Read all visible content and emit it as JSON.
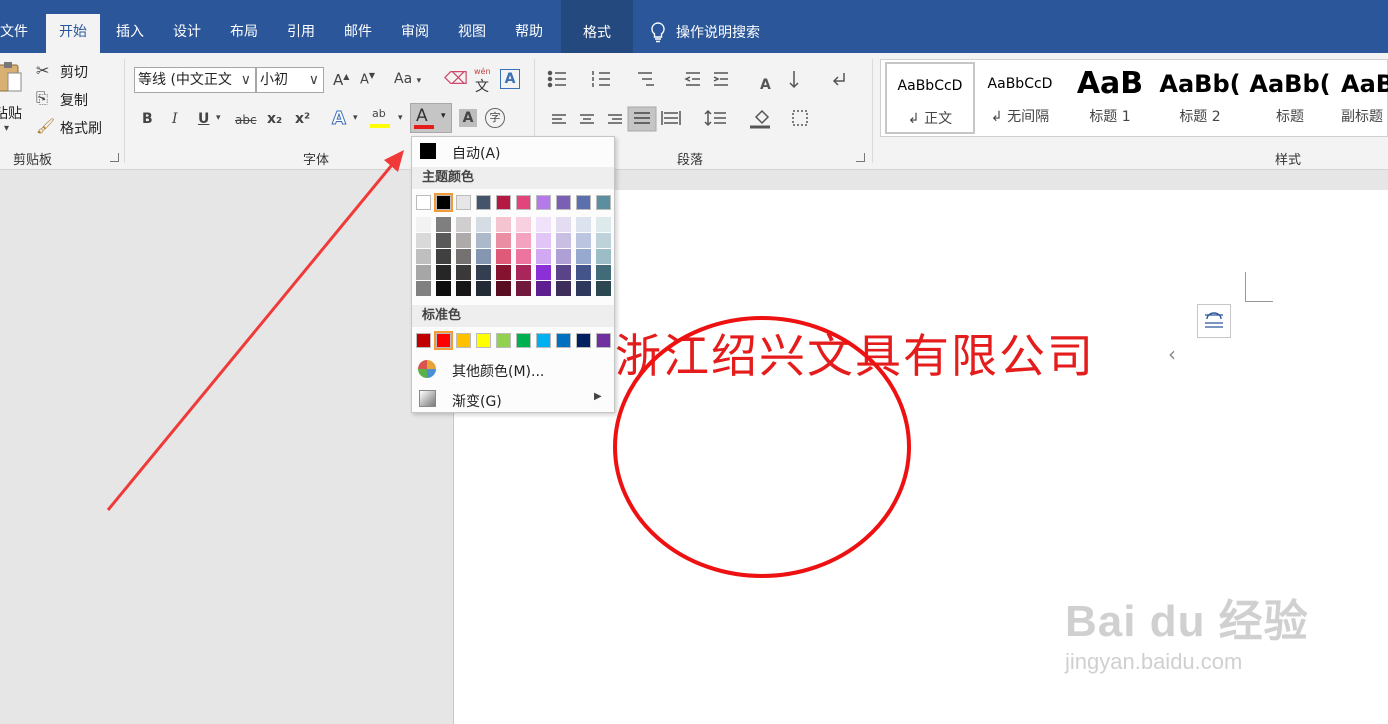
{
  "tabs": [
    "文件",
    "开始",
    "插入",
    "设计",
    "布局",
    "引用",
    "邮件",
    "审阅",
    "视图",
    "帮助"
  ],
  "active_tab": "开始",
  "format_tab": "格式",
  "tell_me": "操作说明搜索",
  "clipboard": {
    "paste": "粘贴",
    "cut": "剪切",
    "copy": "复制",
    "format_painter": "格式刷",
    "group_label": "剪贴板"
  },
  "font": {
    "font_name": "等线 (中文正文",
    "font_size": "小初",
    "group_label": "字体",
    "aa": "Aa",
    "bold": "B",
    "italic": "I",
    "underline": "U",
    "strike": "abc",
    "sub": "x₂",
    "sup": "x²",
    "phonetic_top": "wén",
    "phonetic_bottom": "文",
    "boxed": "A",
    "grow": "A",
    "shrink": "A",
    "effects": "A",
    "highlight": "ab",
    "font_color": "A",
    "char_shade": "A",
    "enclosed": "字",
    "highlight_color": "#ffff00",
    "font_color_bar": "#e51c1c"
  },
  "paragraph": {
    "group_label": "段落"
  },
  "styles": {
    "group_label": "样式",
    "items": [
      {
        "sample": "AaBbCcD",
        "name": "↲ 正文"
      },
      {
        "sample": "AaBbCcD",
        "name": "↲ 无间隔"
      },
      {
        "sample": "AaB",
        "name": "标题 1"
      },
      {
        "sample": "AaBb(",
        "name": "标题 2"
      },
      {
        "sample": "AaBb(",
        "name": "标题"
      },
      {
        "sample": "AaB",
        "name": "副标题"
      }
    ]
  },
  "color_menu": {
    "auto": "自动(A)",
    "theme_header": "主题颜色",
    "standard_header": "标准色",
    "more_colors": "其他颜色(M)...",
    "gradient": "渐变(G)",
    "theme_top": [
      "#ffffff",
      "#000000",
      "#e7e6e6",
      "#44546a",
      "#b31942",
      "#e0457b",
      "#b57aea",
      "#7a5fb5",
      "#5b6fae",
      "#5b8fa0"
    ],
    "theme_shades": [
      [
        "#f2f2f2",
        "#d9d9d9",
        "#bfbfbf",
        "#a6a6a6",
        "#808080"
      ],
      [
        "#7f7f7f",
        "#595959",
        "#404040",
        "#262626",
        "#0d0d0d"
      ],
      [
        "#d0cece",
        "#aeaaaa",
        "#757171",
        "#3a3838",
        "#171616"
      ],
      [
        "#d6dce4",
        "#acb9ca",
        "#8496b0",
        "#333f50",
        "#222a35"
      ],
      [
        "#f4c4d1",
        "#ea8ea4",
        "#df5a79",
        "#851330",
        "#590d20"
      ],
      [
        "#f9d0df",
        "#f3a2bf",
        "#ec749f",
        "#a82659",
        "#70193c"
      ],
      [
        "#f0e2fb",
        "#e1c5f6",
        "#d1a8f2",
        "#8b2fd6",
        "#5d1f8f"
      ],
      [
        "#e4ddf1",
        "#c9bfe2",
        "#ae9fd4",
        "#5a4489",
        "#3c2d5b"
      ],
      [
        "#dde2ef",
        "#bbc5df",
        "#98a9cf",
        "#43548a",
        "#2d385c"
      ],
      [
        "#dee9ec",
        "#bdd2d9",
        "#9cbcc6",
        "#426b78",
        "#2c4750"
      ]
    ],
    "standard": [
      "#c00000",
      "#ff0000",
      "#ffc000",
      "#ffff00",
      "#92d050",
      "#00b050",
      "#00b0f0",
      "#0070c0",
      "#002060",
      "#7030a0"
    ],
    "selected_theme_index": 1,
    "selected_standard_index": 1
  },
  "document": {
    "company": "浙江绍兴文具有限公司",
    "text_color": "#e51c1c",
    "circle_color": "#ee1111"
  },
  "watermark": {
    "main": "Bai du 经验",
    "sub": "jingyan.baidu.com"
  },
  "arrow_color": "#f03a3a"
}
